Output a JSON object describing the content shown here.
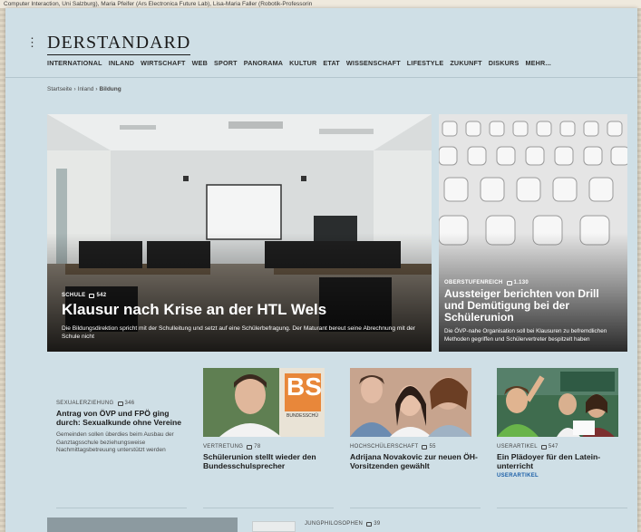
{
  "background_strip": "Computer Interaction, Uni Salzburg), Maria Pfeifer (Ars Electronica Future Lab), Lisa-Maria Faller (Robotik-Professorin",
  "header": {
    "menu_icon": "kebab-menu-icon",
    "logo": "DERSTANDARD",
    "nav": [
      "INTERNATIONAL",
      "INLAND",
      "WIRTSCHAFT",
      "WEB",
      "SPORT",
      "PANORAMA",
      "KULTUR",
      "ETAT",
      "WISSENSCHAFT",
      "LIFESTYLE",
      "ZUKUNFT",
      "DISKURS",
      "MEHR..."
    ]
  },
  "breadcrumb": {
    "items": [
      "Startseite",
      "Inland",
      "Bildung"
    ],
    "separator": "›"
  },
  "hero": {
    "kicker": "SCHULE",
    "comments": "542",
    "title": "Klausur nach Krise an der HTL Wels",
    "teaser": "Die Bildungsdirektion spricht mit der Schulleitung und setzt auf eine Schülerbefragung. Der Maturant bereut seine Abrechnung mit der Schule nicht"
  },
  "side_story": {
    "kicker": "OBERSTUFENREICH",
    "comments": "1.130",
    "title": "Aussteiger berichten von Drill und Demütigung bei der Schülerunion",
    "teaser": "Die ÖVP-nahe Organisation soll bei Klausuren zu befremdlichen Methoden gegriffen und Schülervertreter bespitzelt haben"
  },
  "cards": [
    {
      "kicker": "SEXUALERZIEHUNG",
      "comments": "346",
      "title": "Antrag von ÖVP und FPÖ ging durch: Sexualkunde ohne Vereine",
      "teaser": "Gemeinden sollen überdies beim Ausbau der Ganztagsschule bezie­hungsweise Nachmittagsbetreuung unterstützt werden"
    },
    {
      "kicker": "VERTRETUNG",
      "comments": "78",
      "title": "Schülerunion stellt wieder den Bundesschulsprecher",
      "thumb_text": "BS",
      "thumb_subtext": "BUNDESSCHÜ"
    },
    {
      "kicker": "HOCHSCHÜLERSCHAFT",
      "comments": "55",
      "title": "Adrijana Novakovic zur neuen ÖH-Vorsitzenden gewählt"
    },
    {
      "kicker": "USERARTIKEL",
      "comments": "547",
      "title": "Ein Plädoyer für den Latein­unterricht",
      "tag": "USERARTIKEL"
    }
  ],
  "bottom_row": {
    "kicker": "JUNGPHILOSOPHEN",
    "comments": "39"
  },
  "colors": {
    "page_bg": "#cfdfe6",
    "link_blue": "#1b5fa8",
    "text_dark": "#1b1b1b"
  }
}
